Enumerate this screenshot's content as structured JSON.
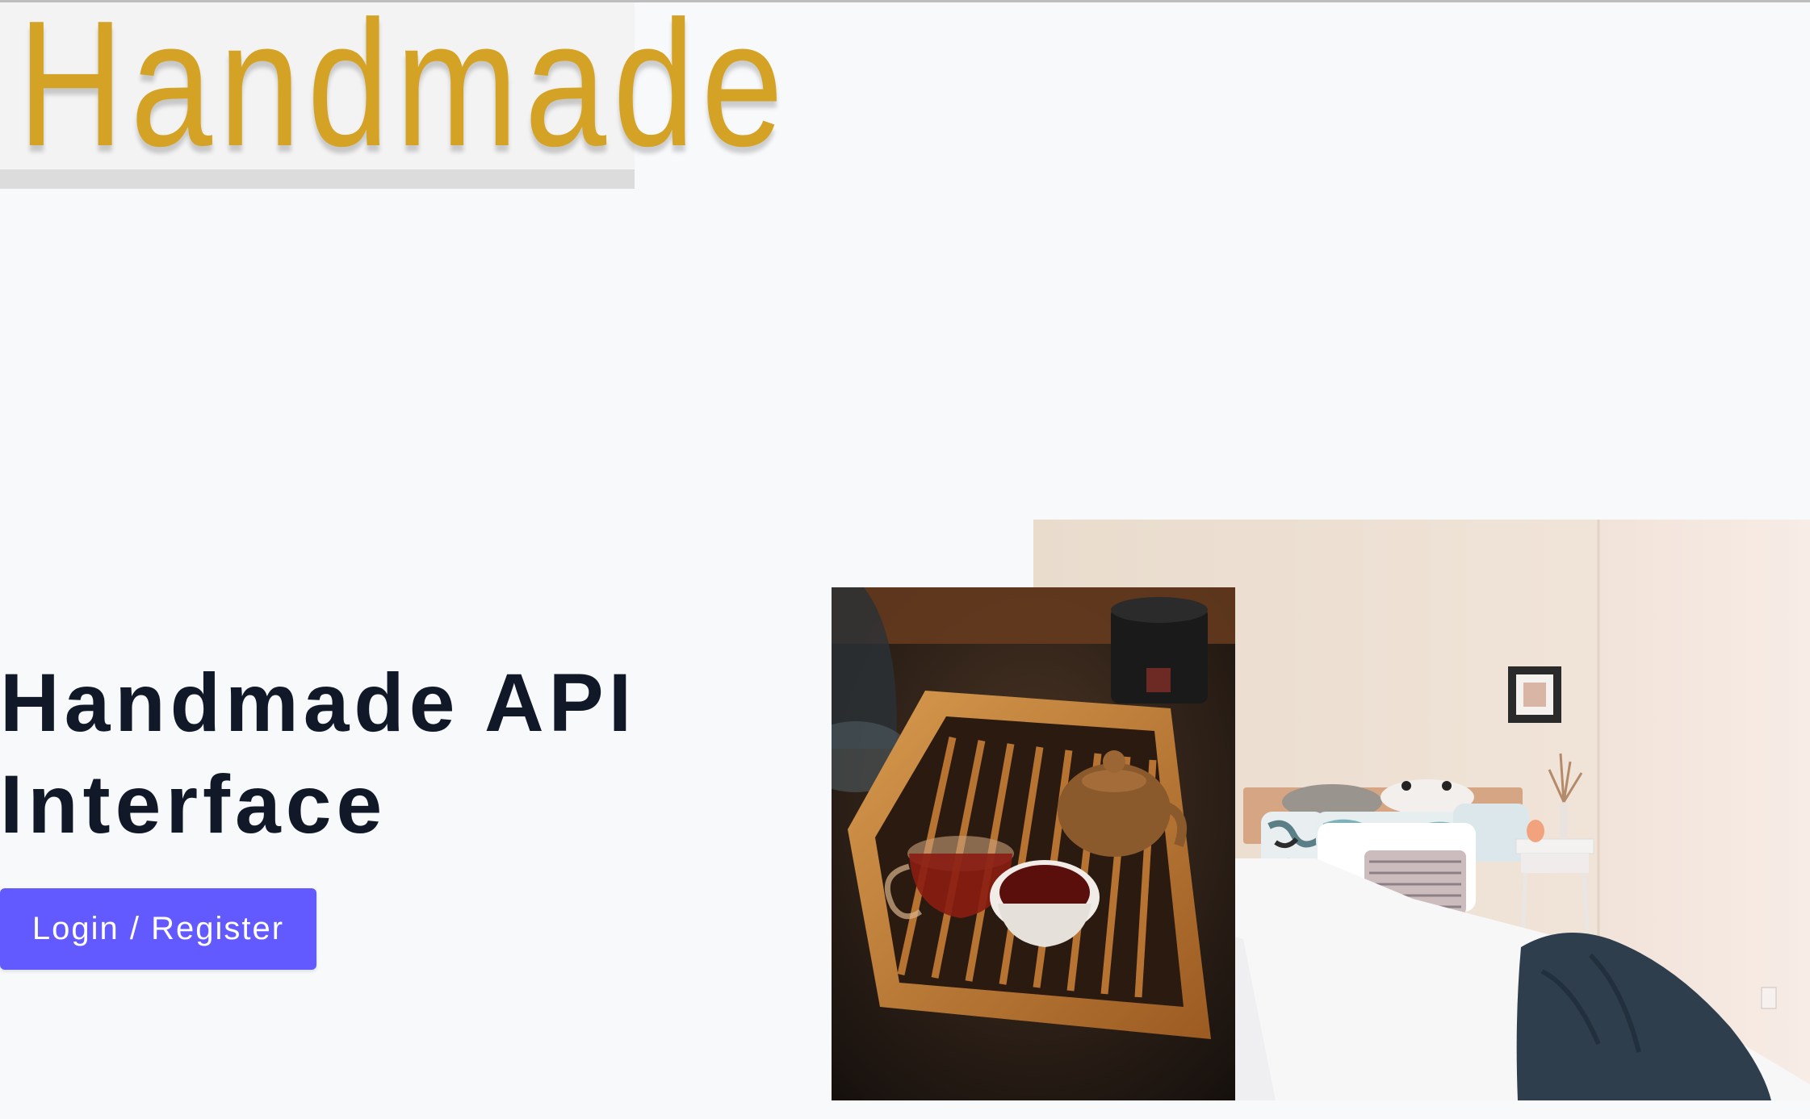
{
  "logo": {
    "text": "Handmade",
    "color": "#d4a325"
  },
  "hero": {
    "title_line1": "Handmade API",
    "title_line2": "Interface",
    "cta_label": "Login / Register",
    "accent_color": "#6259ff"
  },
  "images": {
    "bedroom": {
      "alt": "Bedroom with white bed, patterned pillows and a navy throw blanket"
    },
    "tea": {
      "alt": "Wooden tea tray with teapot, glass pitcher and a cup of tea"
    }
  }
}
